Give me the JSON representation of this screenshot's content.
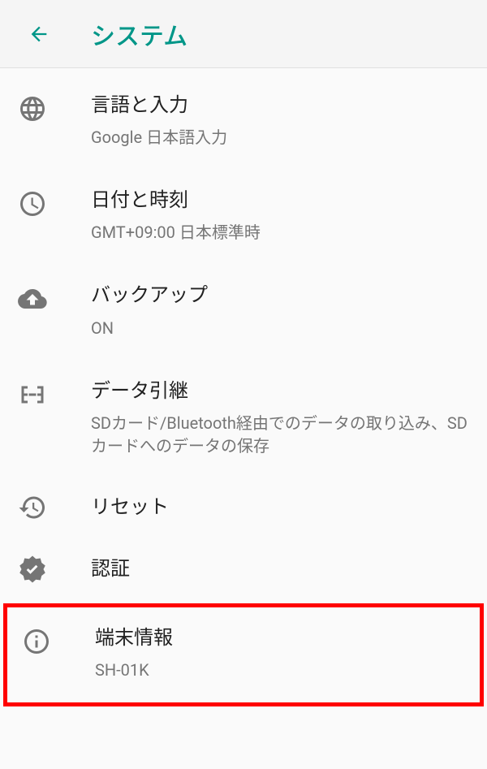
{
  "header": {
    "title": "システム"
  },
  "items": [
    {
      "title": "言語と入力",
      "subtitle": "Google 日本語入力"
    },
    {
      "title": "日付と時刻",
      "subtitle": "GMT+09:00 日本標準時"
    },
    {
      "title": "バックアップ",
      "subtitle": "ON"
    },
    {
      "title": "データ引継",
      "subtitle": "SDカード/Bluetooth経由でのデータの取り込み、SDカードへのデータの保存"
    },
    {
      "title": "リセット"
    },
    {
      "title": "認証"
    },
    {
      "title": "端末情報",
      "subtitle": "SH-01K"
    }
  ]
}
